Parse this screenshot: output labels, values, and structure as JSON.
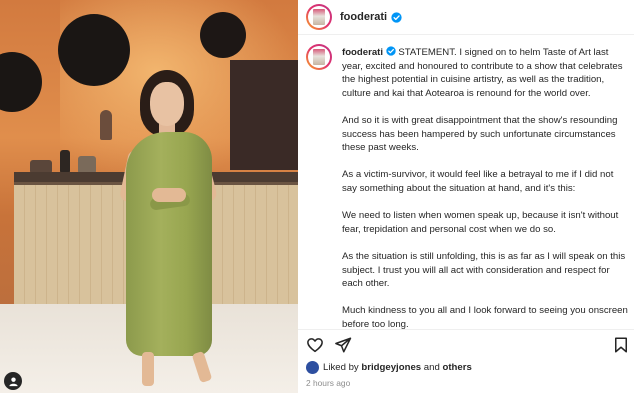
{
  "post": {
    "username": "fooderati",
    "verified": true,
    "caption_paragraphs": [
      "STATEMENT. I signed on to helm Taste of Art last year, excited and honoured to contribute to a show that celebrates the highest potential in cuisine artistry, as well as the tradition, culture and kai that Aotearoa is renound for the world over.",
      "And so it is with great disappointment that the show's resounding success has been hampered by such unfortunate circumstances these past weeks.",
      "As a victim-survivor, it would feel like a betrayal to me if I did not say something about the situation at hand, and it's this:",
      "We need to listen when women speak up, because it isn't without fear, trepidation and personal cost when we do so.",
      "As the situation is still unfolding, this is as far as I will speak on this subject. I trust you will all act with consideration and respect for each other.",
      "Much kindness to you all and I look forward to seeing you onscreen before too long."
    ],
    "likes": {
      "prefix": "Liked by",
      "user": "bridgeyjones",
      "connector": "and",
      "others": "others"
    },
    "timestamp": "2 hours ago"
  },
  "icons": {
    "verified": "verified-badge-icon",
    "like": "heart-icon",
    "share": "paper-plane-icon",
    "save": "bookmark-icon",
    "tagged": "user-tag-icon"
  },
  "colors": {
    "verified": "#0095f6",
    "dress": "#98a650",
    "text": "#262626",
    "muted": "#8e8e8e"
  }
}
